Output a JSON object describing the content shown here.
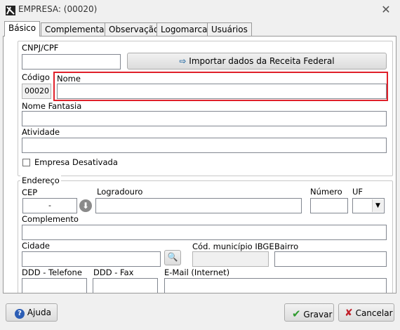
{
  "window": {
    "title": "EMPRESA: (00020)",
    "colors": {
      "highlight": "#e0202a",
      "accent_green": "#2e9b2e",
      "accent_red": "#c0202a"
    }
  },
  "tabs": [
    {
      "label": "Básico",
      "active": true
    },
    {
      "label": "Complementar"
    },
    {
      "label": "Observação"
    },
    {
      "label": "Logomarca"
    },
    {
      "label": "Usuários"
    }
  ],
  "basic": {
    "cnpj_label": "CNPJ/CPF",
    "cnpj_value": "",
    "import_button": "Importar dados da Receita Federal",
    "codigo_label": "Código",
    "codigo_value": "00020",
    "nome_label": "Nome",
    "nome_value": "",
    "nome_fantasia_label": "Nome Fantasia",
    "atividade_label": "Atividade",
    "empresa_desativada_label": "Empresa Desativada",
    "empresa_desativada_checked": false
  },
  "endereco": {
    "group_label": "Endereço",
    "cep_label": "CEP",
    "cep_value": "-",
    "logradouro_label": "Logradouro",
    "numero_label": "Número",
    "uf_label": "UF",
    "complemento_label": "Complemento",
    "cidade_label": "Cidade",
    "cod_ibge_label": "Cód. município IBGE",
    "bairro_label": "Bairro",
    "ddd_telefone_label": "DDD - Telefone",
    "ddd_fax_label": "DDD - Fax",
    "email_label": "E-Mail (Internet)"
  },
  "footer": {
    "help_button": "Ajuda",
    "save_button": "Gravar",
    "cancel_button": "Cancelar"
  }
}
